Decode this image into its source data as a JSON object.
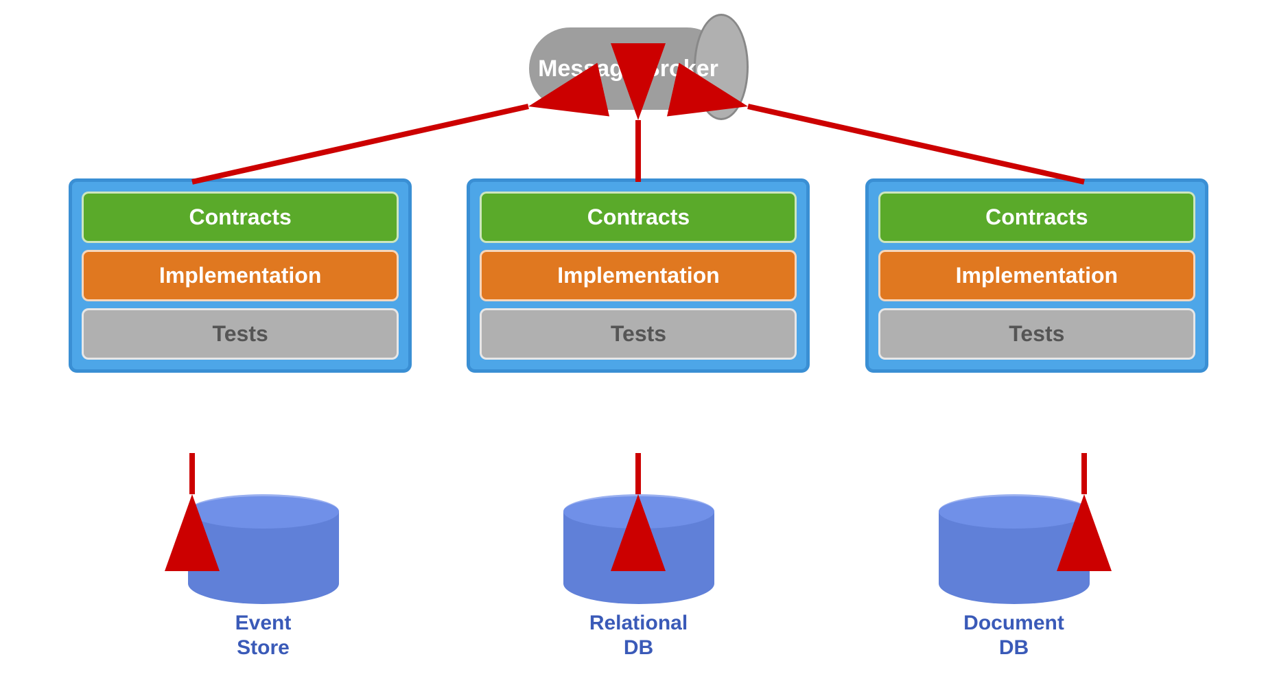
{
  "broker": {
    "label": "Message\nBroker"
  },
  "services": [
    {
      "id": "service-left",
      "layers": [
        {
          "type": "contracts",
          "label": "Contracts"
        },
        {
          "type": "implementation",
          "label": "Implementation"
        },
        {
          "type": "tests",
          "label": "Tests"
        }
      ]
    },
    {
      "id": "service-center",
      "layers": [
        {
          "type": "contracts",
          "label": "Contracts"
        },
        {
          "type": "implementation",
          "label": "Implementation"
        },
        {
          "type": "tests",
          "label": "Tests"
        }
      ]
    },
    {
      "id": "service-right",
      "layers": [
        {
          "type": "contracts",
          "label": "Contracts"
        },
        {
          "type": "implementation",
          "label": "Implementation"
        },
        {
          "type": "tests",
          "label": "Tests"
        }
      ]
    }
  ],
  "databases": [
    {
      "id": "db-event-store",
      "label": "Event\nStore"
    },
    {
      "id": "db-relational",
      "label": "Relational\nDB"
    },
    {
      "id": "db-document",
      "label": "Document\nDB"
    }
  ],
  "colors": {
    "broker_bg": "#9e9e9e",
    "broker_cap": "#b8b8b8",
    "service_bg": "#4da6e8",
    "contracts": "#5aaa2a",
    "implementation": "#e07820",
    "tests": "#b0b0b0",
    "db": "#6080d8",
    "arrow": "#cc0000"
  }
}
